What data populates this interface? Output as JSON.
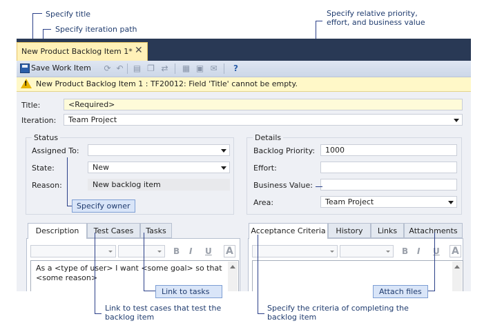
{
  "callouts": {
    "specify_title": "Specify title",
    "specify_iteration": "Specify iteration path",
    "specify_priority": "Specify relative priority, effort, and business value",
    "specify_owner": "Specify owner",
    "link_tasks": "Link to tasks",
    "attach_files": "Attach files",
    "link_test_cases": "Link to test cases that test the backlog item",
    "specify_criteria": "Specify the criteria of completing the backlog item"
  },
  "document_tab": {
    "label": "New Product Backlog Item 1*",
    "close_icon": "close-icon"
  },
  "toolbar": {
    "save_label": "Save Work Item"
  },
  "warning": {
    "icon": "warning-icon",
    "text": "New Product Backlog Item 1 : TF20012: Field 'Title' cannot be empty."
  },
  "form": {
    "title_label": "Title:",
    "title_value": "<Required>",
    "iteration_label": "Iteration:",
    "iteration_value": "Team Project",
    "status": {
      "group_title": "Status",
      "assigned_label": "Assigned To:",
      "assigned_value": "",
      "state_label": "State:",
      "state_value": "New",
      "reason_label": "Reason:",
      "reason_value": "New backlog item"
    },
    "details": {
      "group_title": "Details",
      "priority_label": "Backlog Priority:",
      "priority_value": "1000",
      "effort_label": "Effort:",
      "effort_value": "",
      "business_value_label": "Business Value:",
      "business_value_value": "",
      "area_label": "Area:",
      "area_value": "Team Project"
    }
  },
  "left_tabs": [
    "Description",
    "Test Cases",
    "Tasks"
  ],
  "right_tabs": [
    "Acceptance Criteria",
    "History",
    "Links",
    "Attachments"
  ],
  "formatting": {
    "bold": "B",
    "italic": "I",
    "underline": "U",
    "font_color": "A"
  },
  "description_text": "As a <type of user> I want <some goal> so that <some reason>",
  "colors": {
    "tab_strip": "#293955",
    "active_doc_tab": "#fff1b8",
    "callout_fill": "#d9e5f8",
    "leader_line": "#2a3f88"
  }
}
